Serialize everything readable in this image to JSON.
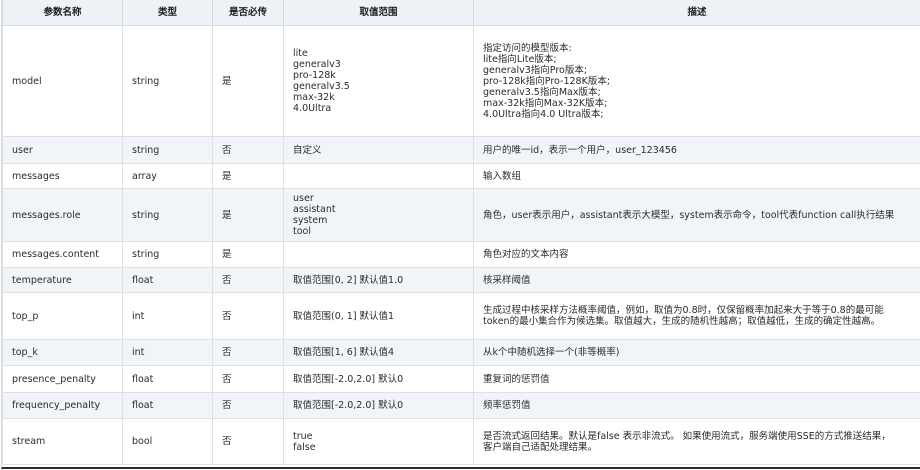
{
  "headers": [
    "参数名称",
    "类型",
    "是否必传",
    "取值范围",
    "描述"
  ],
  "rows": [
    {
      "name": "model",
      "type": "string",
      "required": "是",
      "range": [
        "lite",
        "generalv3",
        "pro-128k",
        "generalv3.5",
        "max-32k",
        "4.0Ultra"
      ],
      "desc": [
        "指定访问的模型版本:",
        "lite指向Lite版本;",
        "generalv3指向Pro版本;",
        "pro-128k指向Pro-128K版本;",
        "generalv3.5指向Max版本;",
        "max-32k指向Max-32K版本;",
        "4.0Ultra指向4.0 Ultra版本;"
      ]
    },
    {
      "name": "user",
      "type": "string",
      "required": "否",
      "range": [
        "自定义"
      ],
      "desc": [
        "用户的唯一id，表示一个用户，user_123456"
      ]
    },
    {
      "name": "messages",
      "type": "array",
      "required": "是",
      "range": [],
      "desc": [
        "输入数组"
      ]
    },
    {
      "name": "messages.role",
      "type": "string",
      "required": "是",
      "range": [
        "user",
        "assistant",
        "system",
        "tool"
      ],
      "desc": [
        "角色，user表示用户，assistant表示大模型，system表示命令，tool代表function call执行结果"
      ]
    },
    {
      "name": "messages.content",
      "type": "string",
      "required": "是",
      "range": [],
      "desc": [
        "角色对应的文本内容"
      ]
    },
    {
      "name": "temperature",
      "type": "float",
      "required": "否",
      "range": [
        "取值范围[0, 2] 默认值1.0"
      ],
      "desc": [
        "核采样阈值"
      ]
    },
    {
      "name": "top_p",
      "type": "int",
      "required": "否",
      "range": [
        "取值范围(0, 1] 默认值1"
      ],
      "desc": [
        "生成过程中核采样方法概率阈值，例如，取值为0.8时，仅保留概率加起来大于等于0.8的最可能",
        "token的最小集合作为候选集。取值越大，生成的随机性越高；取值越低，生成的确定性越高。"
      ]
    },
    {
      "name": "top_k",
      "type": "int",
      "required": "否",
      "range": [
        "取值范围[1, 6] 默认值4"
      ],
      "desc": [
        "从k个中随机选择一个(非等概率)"
      ]
    },
    {
      "name": "presence_penalty",
      "type": "float",
      "required": "否",
      "range": [
        "取值范围[-2.0,2.0] 默认0"
      ],
      "desc": [
        "重复词的惩罚值"
      ]
    },
    {
      "name": "frequency_penalty",
      "type": "float",
      "required": "否",
      "range": [
        "取值范围[-2.0,2.0] 默认0"
      ],
      "desc": [
        "频率惩罚值"
      ]
    },
    {
      "name": "stream",
      "type": "bool",
      "required": "否",
      "range": [
        "true",
        "false"
      ],
      "desc": [
        "是否流式返回结果。默认是false 表示非流式。 如果使用流式，服务端使用SSE的方式推送结果，",
        "客户端自己适配处理结果。"
      ]
    }
  ]
}
